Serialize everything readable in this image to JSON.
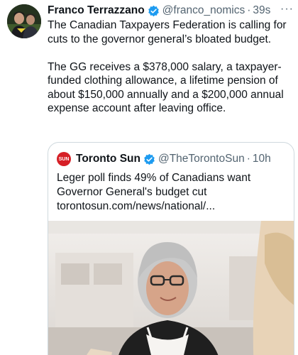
{
  "author": {
    "name": "Franco Terrazzano",
    "handle": "@franco_nomics",
    "separator": "·",
    "time": "39s",
    "more_icon": "···"
  },
  "tweet": {
    "paragraph1": "The Canadian Taxpayers Federation is calling for cuts to the governor general’s bloated budget.",
    "paragraph2": "The GG receives a $378,000 salary, a taxpayer-funded clothing allowance, a lifetime pension of about $150,000 annually and a $200,000 annual expense account after leaving office."
  },
  "quoted": {
    "logo_text": "SUN",
    "name": "Toronto Sun",
    "handle": "@TheTorontoSun",
    "separator": "·",
    "time": "10h",
    "line1": "Leger poll finds 49% of Canadians want",
    "line2": "Governor General's budget cut",
    "link": "torontosun.com/news/national/..."
  },
  "colors": {
    "verified": "#1d9bf0",
    "sun_logo": "#d61f26",
    "secondary_text": "#536471"
  }
}
